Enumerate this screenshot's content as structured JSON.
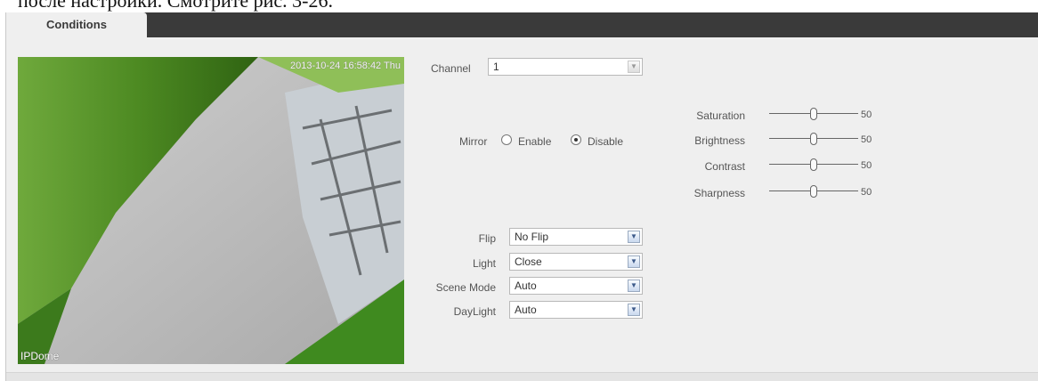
{
  "caption": "после настройки.   Смотрите рис. 3-26.",
  "tabs": [
    {
      "label": "Conditions",
      "active": true
    }
  ],
  "preview": {
    "timestamp": "2013-10-24 16:58:42 Thu",
    "camera_name": "IPDome"
  },
  "channel": {
    "label": "Channel",
    "value": "1"
  },
  "mirror": {
    "label": "Mirror",
    "options": [
      "Enable",
      "Disable"
    ],
    "selected": "Disable"
  },
  "sliders": [
    {
      "label": "Saturation",
      "value": 50
    },
    {
      "label": "Brightness",
      "value": 50
    },
    {
      "label": "Contrast",
      "value": 50
    },
    {
      "label": "Sharpness",
      "value": 50
    }
  ],
  "selects": [
    {
      "label": "Flip",
      "value": "No Flip"
    },
    {
      "label": "Light",
      "value": "Close"
    },
    {
      "label": "Scene Mode",
      "value": "Auto"
    },
    {
      "label": "DayLight",
      "value": "Auto"
    }
  ],
  "colors": {
    "tab_bar": "#3a3a3a",
    "panel_bg": "#efefef",
    "accent": "#3c5a8a"
  }
}
